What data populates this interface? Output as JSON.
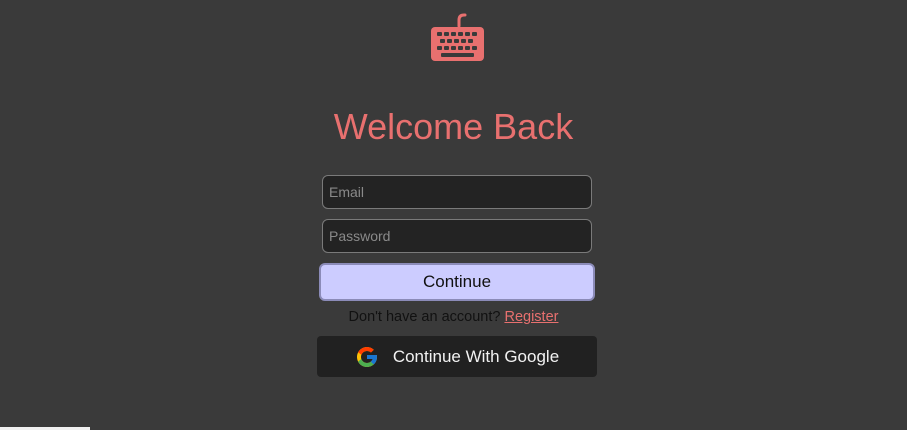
{
  "logo": {
    "icon": "keyboard-icon",
    "color": "#e8706f"
  },
  "title": "Welcome Back",
  "form": {
    "email_placeholder": "Email",
    "email_value": "",
    "password_placeholder": "Password",
    "password_value": "",
    "continue_label": "Continue"
  },
  "register": {
    "prompt": "Don't have an account?",
    "link_label": "Register"
  },
  "google": {
    "icon": "google-icon",
    "label": "Continue With Google"
  },
  "colors": {
    "background": "#3a3a3a",
    "accent": "#e8706f",
    "continue_button": "#ccccff",
    "google_button": "#212121"
  }
}
